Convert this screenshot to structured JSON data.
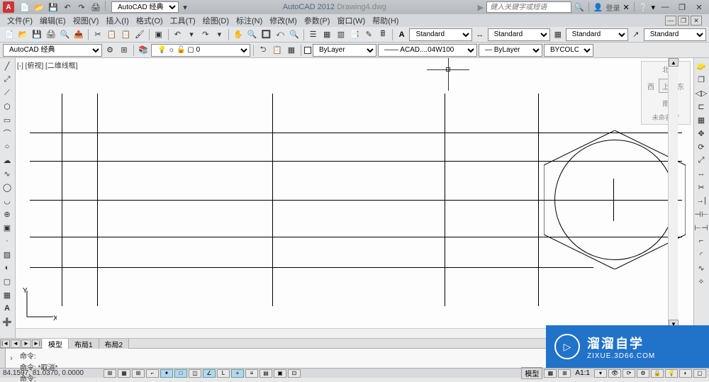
{
  "title": {
    "app": "AutoCAD 2012",
    "file": "Drawing4.dwg",
    "workspace": "AutoCAD 经典",
    "search_placeholder": "健入关键字或短语",
    "login": "登录"
  },
  "menus": [
    "文件(F)",
    "编辑(E)",
    "视图(V)",
    "插入(I)",
    "格式(O)",
    "工具(T)",
    "绘图(D)",
    "标注(N)",
    "修改(M)",
    "参数(P)",
    "窗口(W)",
    "帮助(H)"
  ],
  "toolbar": {
    "workspace": "AutoCAD 经典",
    "style1": "Standard",
    "style2": "Standard",
    "style3": "Standard",
    "style4": "Standard",
    "layer_color": "0",
    "layer_current": "ByLayer",
    "linetype": "ACAD....04W100",
    "lineweight": "ByLayer",
    "plotstyle": "BYCOLOR"
  },
  "viewport": {
    "label": "[-] [俯视] [二维线框]",
    "viewcube": {
      "top": "北",
      "left": "西",
      "right": "东",
      "bottom": "南",
      "face": "上",
      "below": "未命名 ▽"
    }
  },
  "tabs": [
    "模型",
    "布局1",
    "布局2"
  ],
  "active_tab": 0,
  "cmdline": {
    "line1": "命令:",
    "line2": "命令: *取消*",
    "prompt": "命令:"
  },
  "status": {
    "coords": "84.1597, 81.0370, 0.0000",
    "space_label": "模型",
    "scale": "A1:1"
  },
  "ucs": {
    "x": "X",
    "y": "Y"
  },
  "watermark": {
    "cn": "溜溜自学",
    "en": "ZIXUE.3D66.COM",
    "play": "▷"
  }
}
